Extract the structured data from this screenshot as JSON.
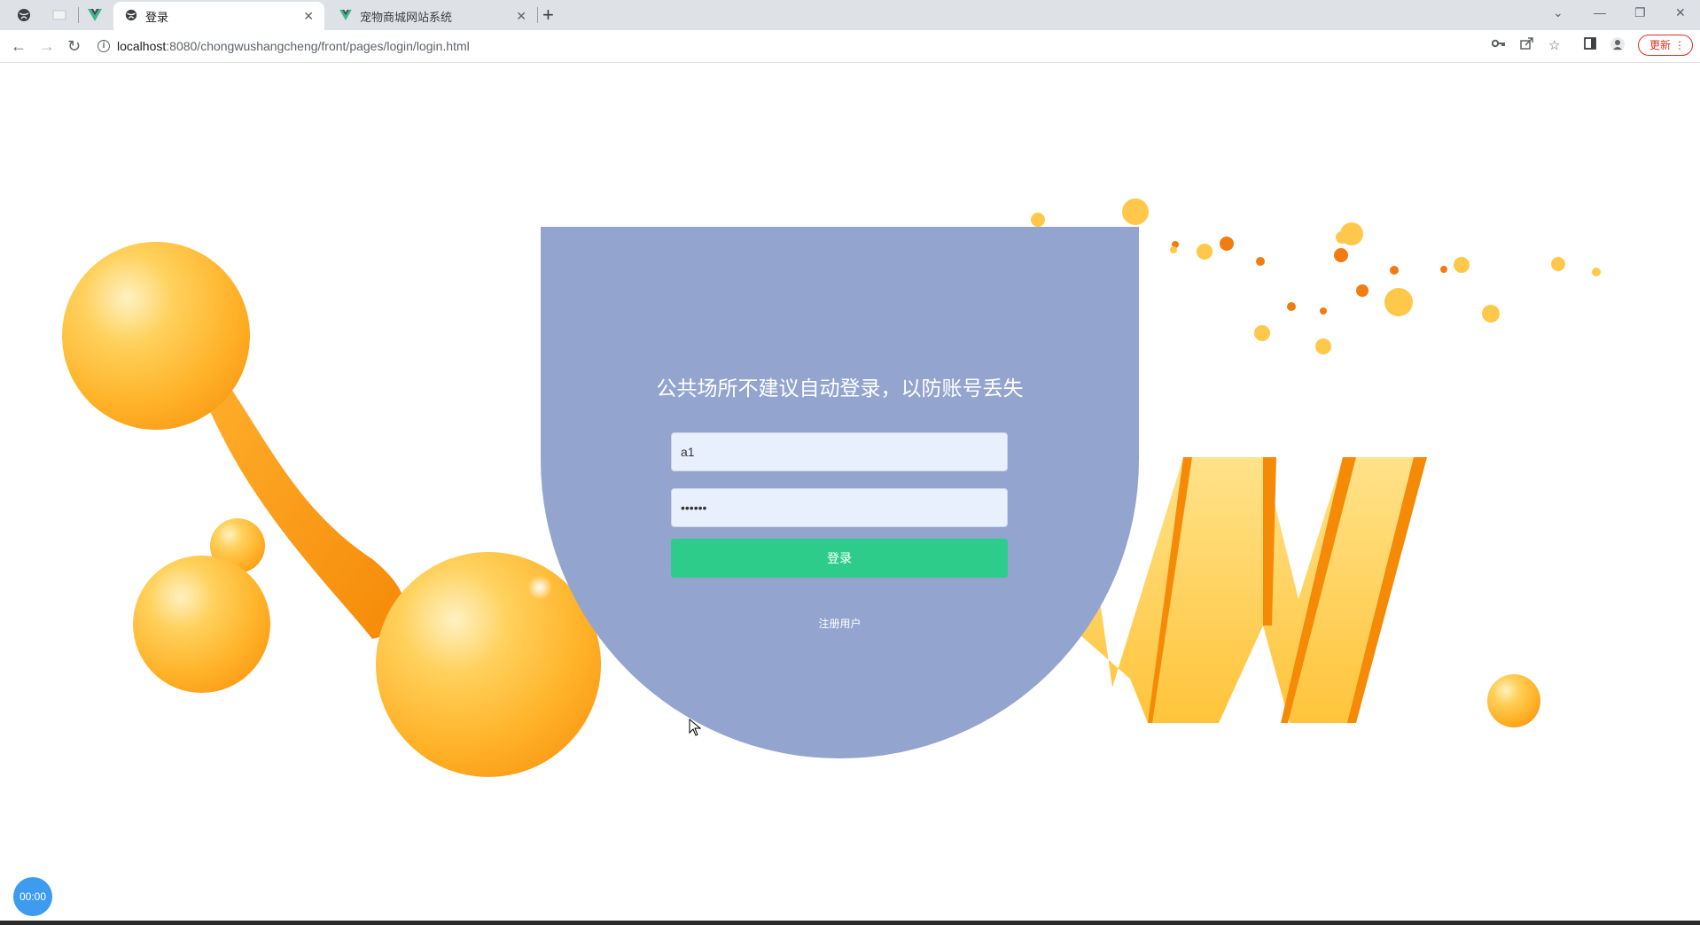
{
  "browser": {
    "tabs": [
      {
        "title": "登录",
        "icon": "globe-icon",
        "active": true
      },
      {
        "title": "宠物商城网站系统",
        "icon": "vue-logo-icon",
        "active": false
      }
    ],
    "url_host": "localhost",
    "url_rest": ":8080/chongwushangcheng/front/pages/login/login.html",
    "update_label": "更新",
    "icons": [
      "key-icon",
      "share-icon",
      "star-icon",
      "sidepanel-icon",
      "profile-icon"
    ]
  },
  "login": {
    "heading": "公共场所不建议自动登录，以防账号丢失",
    "username_value": "a1",
    "password_value": "111111",
    "login_button": "登录",
    "register_link": "注册用户"
  },
  "recorder": {
    "time": "00:00"
  },
  "colors": {
    "panel": "#93a5cf",
    "button": "#2ecc8a",
    "accent_orange": "#f58a07"
  }
}
